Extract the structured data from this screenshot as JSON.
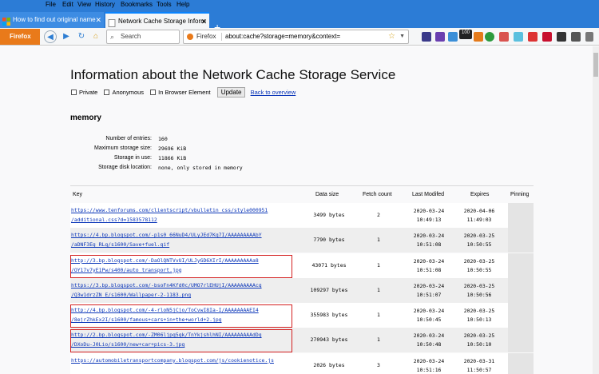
{
  "menu": [
    "File",
    "Edit",
    "View",
    "History",
    "Bookmarks",
    "Tools",
    "Help"
  ],
  "tabs": [
    {
      "title": "How to find out original name",
      "active": false
    },
    {
      "title": "Network Cache Storage Inform",
      "active": true
    }
  ],
  "new_tab_label": "+",
  "nav": {
    "firefox_label": "Firefox",
    "search_placeholder": "Search",
    "identity_label": "Firefox",
    "url": "about:cache?storage=memory&context=",
    "badge": "100"
  },
  "page": {
    "title": "Information about the Network Cache Storage Service",
    "options": [
      {
        "label": "Private",
        "checked": false
      },
      {
        "label": "Anonymous",
        "checked": false
      },
      {
        "label": "In Browser Element",
        "checked": false
      }
    ],
    "update_label": "Update",
    "back_link": "Back to overview",
    "section": "memory",
    "stats": [
      {
        "label": "Number of entries:",
        "value": "160"
      },
      {
        "label": "Maximum storage size:",
        "value": "29696 KiB"
      },
      {
        "label": "Storage in use:",
        "value": "11866 KiB"
      },
      {
        "label": "Storage disk location:",
        "value": "none, only stored in memory"
      }
    ]
  },
  "table": {
    "headers": [
      "Key",
      "Data size",
      "Fetch count",
      "Last Modifed",
      "Expires",
      "Pinning"
    ],
    "rows": [
      {
        "key": [
          "https://www.tenforums.com/clientscript/vbulletin_css/style000951",
          "/additional.css?d=1583578112"
        ],
        "size": "3499 bytes",
        "count": "2",
        "modified": [
          "2020-03-24",
          "10:49:13"
        ],
        "expires": [
          "2020-04-06",
          "11:49:03"
        ],
        "highlight": false
      },
      {
        "key": [
          "https://4.bp.blogspot.com/-p1s0_66NuD4/ULyJEd7Kq7I/AAAAAAAAAbY",
          "/aDNF3Eg_RLg/s1600/Save+fuel.gif"
        ],
        "size": "7790 bytes",
        "count": "1",
        "modified": [
          "2020-03-24",
          "10:51:08"
        ],
        "expires": [
          "2020-03-25",
          "10:50:55"
        ],
        "highlight": false
      },
      {
        "key": [
          "http://3.bp.blogspot.com/-DaOlQNTVvUI/ULJyGD6XIrI/AAAAAAAAAa8",
          "/OY17v7yE1Pw/s400/auto_transport.jpg"
        ],
        "size": "43071 bytes",
        "count": "1",
        "modified": [
          "2020-03-24",
          "10:51:08"
        ],
        "expires": [
          "2020-03-25",
          "10:50:55"
        ],
        "highlight": true
      },
      {
        "key": [
          "https://3.bp.blogspot.com/-bsoFn4Kfd0c/UMO7rlEHUjI/AAAAAAAAAcq",
          "/Q3w1drzZN_E/s1600/Wallpaper-2-1183.png"
        ],
        "size": "109297 bytes",
        "count": "1",
        "modified": [
          "2020-03-24",
          "10:51:07"
        ],
        "expires": [
          "2020-03-25",
          "10:50:56"
        ],
        "highlight": false
      },
      {
        "key": [
          "http://4.bp.blogspot.com/-4-rloN5jCjo/ToCvwI8Ia-I/AAAAAAAAEI4",
          "/8ejrZhkEx2I/s1600/famous+cars+in+the+world+2.jpg"
        ],
        "size": "355983 bytes",
        "count": "1",
        "modified": [
          "2020-03-24",
          "10:50:45"
        ],
        "expires": [
          "2020-03-25",
          "10:50:13"
        ],
        "highlight": true
      },
      {
        "key": [
          "http://2.bp.blogspot.com/-ZM06ljpq5qk/TnYkjshlhNI/AAAAAAAAAdDq",
          "/DXoDu-J0Lio/s1600/new+car+pics-3.jpg"
        ],
        "size": "270943 bytes",
        "count": "1",
        "modified": [
          "2020-03-24",
          "10:50:48"
        ],
        "expires": [
          "2020-03-25",
          "10:50:10"
        ],
        "highlight": true
      },
      {
        "key": [
          "https://automobiletransportcompany.blogspot.com/js/cookienotice.js",
          ""
        ],
        "size": "2026 bytes",
        "count": "3",
        "modified": [
          "2020-03-24",
          "10:51:16"
        ],
        "expires": [
          "2020-03-31",
          "11:50:57"
        ],
        "highlight": false
      }
    ]
  },
  "colors": {
    "accent": "#0a84ff",
    "titlebar": "#2c7cd6",
    "highlight_box": "#d42020",
    "link": "#0b36b9"
  },
  "icons": [
    "back-icon",
    "forward-icon",
    "reload-icon",
    "home-icon",
    "search-icon",
    "star-icon",
    "library-icon"
  ]
}
